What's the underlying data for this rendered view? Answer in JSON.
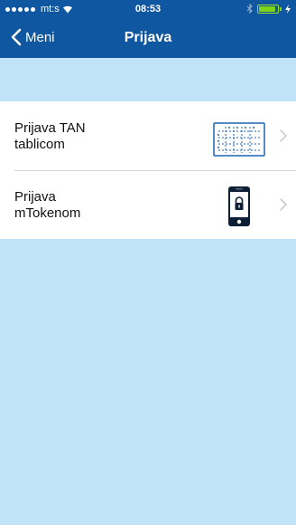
{
  "status_bar": {
    "carrier": "mt:s",
    "time": "08:53",
    "battery_level": 0.9
  },
  "nav": {
    "back_label": "Meni",
    "title": "Prijava"
  },
  "login_options": [
    {
      "label": "Prijava TAN\ntablicom",
      "icon": "tan-table-icon"
    },
    {
      "label": "Prijava\nmTokenom",
      "icon": "mobile-lock-icon"
    }
  ],
  "colors": {
    "header": "#0f57a1",
    "background": "#c0e3f7",
    "tan_icon_blue": "#1f64ad",
    "chevron": "#c7c7cc"
  }
}
